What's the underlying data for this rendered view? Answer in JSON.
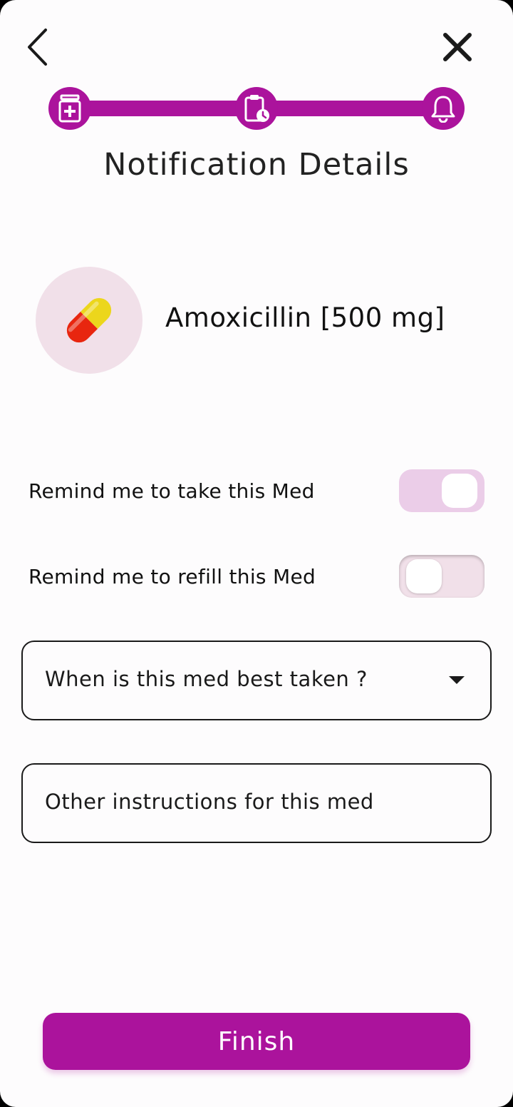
{
  "header": {
    "back_icon": "chevron-left-icon",
    "close_icon": "close-icon",
    "title": "Notification Details"
  },
  "stepper": {
    "steps": [
      {
        "icon": "medicine-bottle-icon",
        "completed": true
      },
      {
        "icon": "clipboard-clock-icon",
        "completed": true
      },
      {
        "icon": "bell-icon",
        "completed": true
      }
    ],
    "accent_color": "#ab139c"
  },
  "medication": {
    "icon": "pill-capsule-icon",
    "name": "Amoxicillin [500 mg]"
  },
  "reminders": {
    "take": {
      "label": "Remind me to take this Med",
      "enabled": true
    },
    "refill": {
      "label": "Remind me to refill this Med",
      "enabled": false
    }
  },
  "best_taken": {
    "placeholder": "When is this med best taken ?",
    "icon": "caret-down-icon"
  },
  "instructions": {
    "placeholder": "Other instructions for this med"
  },
  "finish_button": {
    "label": "Finish",
    "color": "#ab139c"
  }
}
